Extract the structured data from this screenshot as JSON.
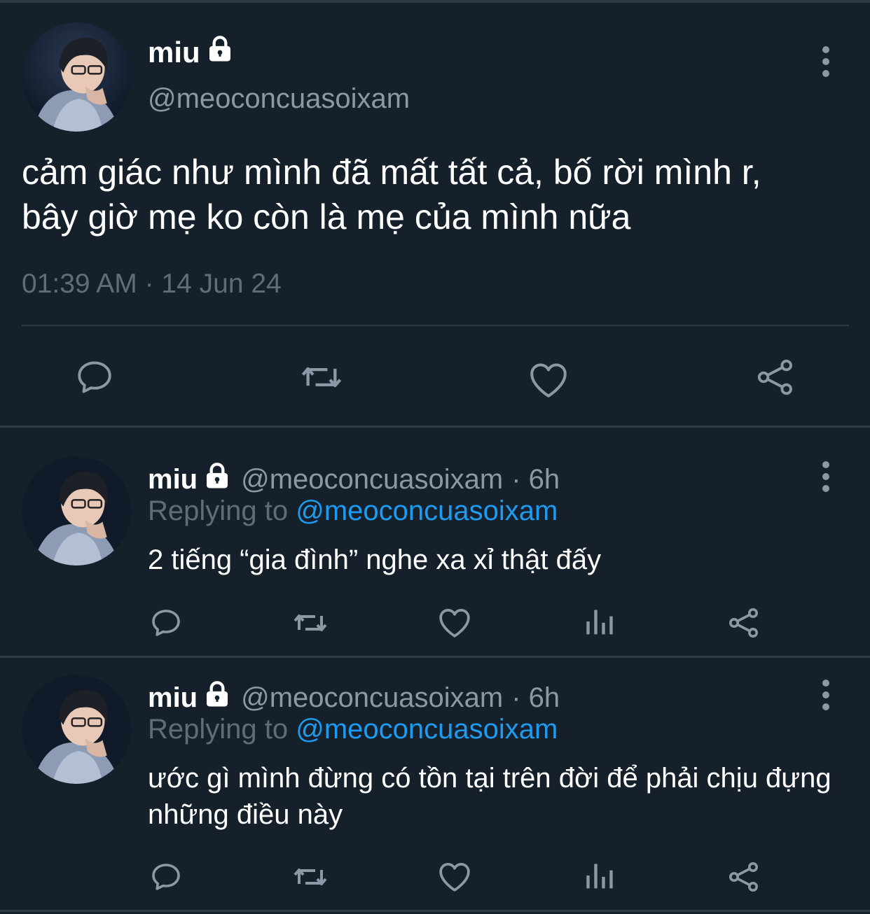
{
  "colors": {
    "background": "#15202b",
    "divider": "#2f3b47",
    "secondary_text": "#8b98a5",
    "muted_text": "#5f6d7a",
    "accent": "#1d9bf0"
  },
  "main_tweet": {
    "author_name": "miu",
    "author_handle": "@meoconcuasoixam",
    "protected_icon": "lock-icon",
    "text": "cảm giác như mình đã mất tất cả, bố rời mình r,\nbây giờ mẹ ko còn là mẹ của mình nữa",
    "timestamp": "01:39 AM · 14 Jun 24",
    "actions": [
      "reply-icon",
      "retweet-icon",
      "like-icon",
      "share-icon"
    ]
  },
  "replies": [
    {
      "author_name": "miu",
      "author_handle": "@meoconcuasoixam",
      "time": "· 6h",
      "replying_prefix": "Replying to",
      "replying_to": "@meoconcuasoixam",
      "text": "2 tiếng “gia đình” nghe xa xỉ thật đấy",
      "actions": [
        "reply-icon",
        "retweet-icon",
        "like-icon",
        "analytics-icon",
        "share-icon"
      ]
    },
    {
      "author_name": "miu",
      "author_handle": "@meoconcuasoixam",
      "time": "· 6h",
      "replying_prefix": "Replying to",
      "replying_to": "@meoconcuasoixam",
      "text": "ước gì mình đừng có tồn tại trên đời để phải chịu đựng những điều này",
      "actions": [
        "reply-icon",
        "retweet-icon",
        "like-icon",
        "analytics-icon",
        "share-icon"
      ]
    }
  ]
}
